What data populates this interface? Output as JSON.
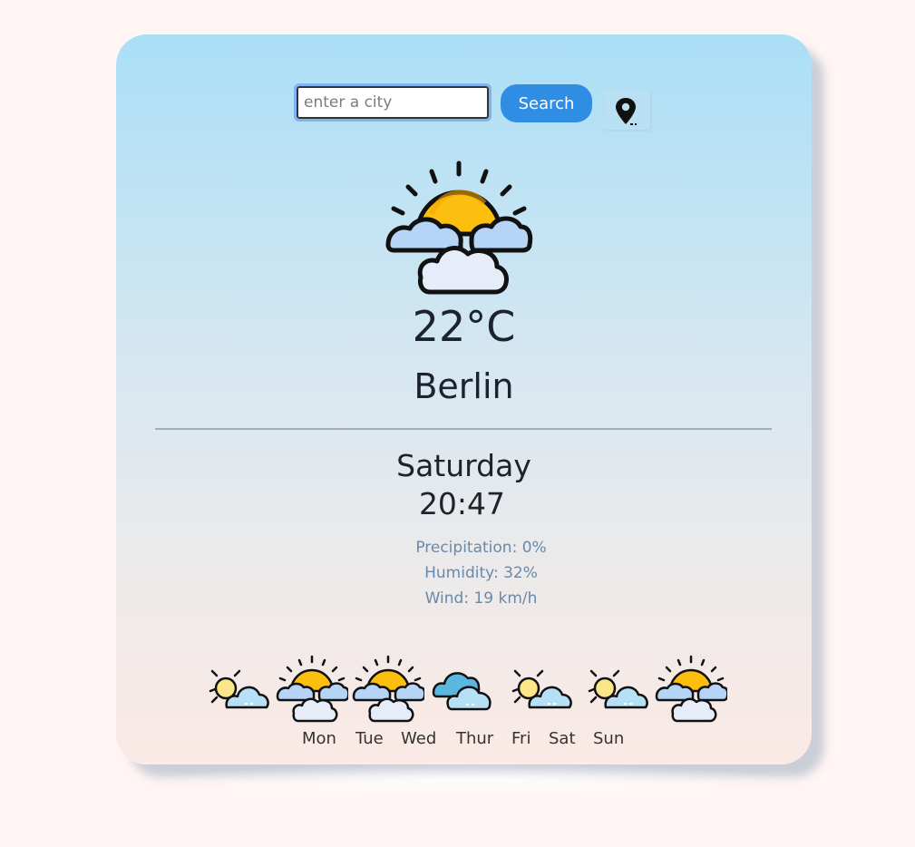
{
  "search": {
    "placeholder": "enter a city",
    "value": "",
    "button_label": "Search",
    "location_icon": "map-pin-icon"
  },
  "current": {
    "icon": "partly-sunny-icon",
    "temperature": "22°C",
    "city": "Berlin",
    "day": "Saturday",
    "time": "20:47",
    "precipitation": "Precipitation: 0%",
    "humidity": "Humidity: 32%",
    "wind": "Wind: 19 km/h"
  },
  "forecast": [
    {
      "day": "Mon",
      "icon": "partly-cloudy-small-sun-icon"
    },
    {
      "day": "Tue",
      "icon": "sun-behind-clouds-icon"
    },
    {
      "day": "Wed",
      "icon": "sun-behind-clouds-icon"
    },
    {
      "day": "Thur",
      "icon": "cloudy-icon"
    },
    {
      "day": "Fri",
      "icon": "partly-cloudy-small-sun-icon"
    },
    {
      "day": "Sat",
      "icon": "partly-cloudy-small-sun-icon"
    },
    {
      "day": "Sun",
      "icon": "sun-behind-clouds-icon"
    }
  ],
  "colors": {
    "accent": "#2f8ee4",
    "sun": "#fcbf0f",
    "cloud_light": "#e6edf8",
    "cloud_blue": "#b6d5f6",
    "detail_text": "#6a89a8",
    "page_background": "#fff5f5"
  }
}
